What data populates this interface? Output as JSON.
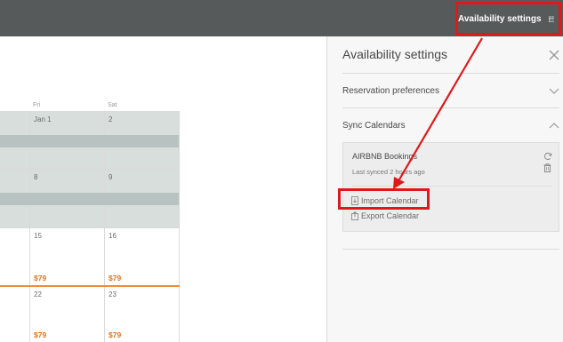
{
  "topbar": {
    "availability_label": "Availability settings",
    "calendar_icon": "calendar-icon"
  },
  "calendar": {
    "day_names": [
      "Fri",
      "Sat"
    ],
    "rows": [
      {
        "days": [
          {
            "num": "Jan 1",
            "price": ""
          },
          {
            "num": "2",
            "price": ""
          }
        ],
        "blocked": true
      },
      {
        "days": [
          {
            "num": "8",
            "price": ""
          },
          {
            "num": "9",
            "price": ""
          }
        ],
        "blocked": true
      },
      {
        "days": [
          {
            "num": "15",
            "price": "$79"
          },
          {
            "num": "16",
            "price": "$79"
          }
        ],
        "blocked": false
      },
      {
        "days": [
          {
            "num": "22",
            "price": "$79"
          },
          {
            "num": "23",
            "price": "$79"
          }
        ],
        "blocked": false
      }
    ],
    "accent_color": "#e0731c"
  },
  "panel": {
    "title": "Availability settings",
    "close_icon": "close-icon",
    "reservation_label": "Reservation preferences",
    "sync_label": "Sync Calendars",
    "sync_card": {
      "name": "AIRBNB Bookings",
      "last_synced": "Last synced 2 hours ago",
      "refresh_icon": "refresh-icon",
      "trash_icon": "trash-icon"
    },
    "import_label": "Import Calendar",
    "export_label": "Export Calendar"
  },
  "annotation_color": "#e0181b"
}
